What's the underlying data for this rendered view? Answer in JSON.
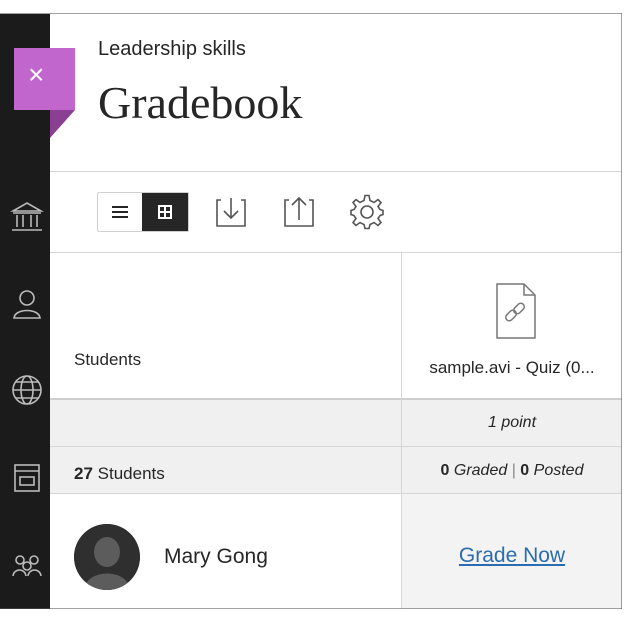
{
  "header": {
    "course_title": "Leadership skills",
    "page_title": "Gradebook"
  },
  "close_button": {
    "label": "×"
  },
  "rail": {
    "icons": [
      "institution-icon",
      "profile-icon",
      "globe-icon",
      "calendar-icon",
      "groups-icon"
    ]
  },
  "toolbar": {
    "list_view": "list-view-icon",
    "grid_view": "grid-view-icon",
    "download": "download-icon",
    "upload": "upload-icon",
    "settings": "gear-icon"
  },
  "table": {
    "students_header": "Students",
    "students_count": "27",
    "students_count_suffix": " Students",
    "item_title": "sample.avi - Quiz (0...",
    "points": "1 point",
    "graded_count": "0",
    "graded_label": " Graded",
    "separator": " | ",
    "posted_count": "0",
    "posted_label": " Posted"
  },
  "student": {
    "name": "Mary Gong",
    "grade_link": "Grade Now"
  },
  "colors": {
    "close_flag": "#c066cc",
    "rail": "#1b1b1b",
    "link": "#2b6cb0"
  }
}
